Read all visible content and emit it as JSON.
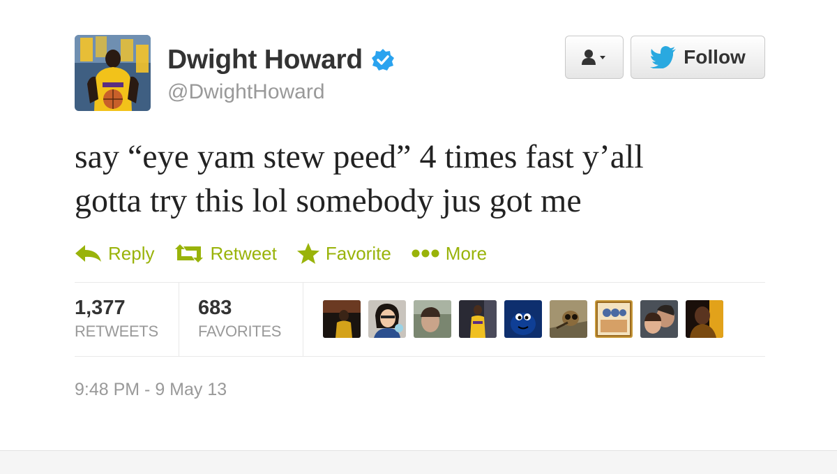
{
  "author": {
    "name": "Dwight Howard",
    "handle": "@DwightHoward",
    "verified": true,
    "avatar_icon": "player-photo-avatar"
  },
  "buttons": {
    "user_menu_icon": "user-dropdown-icon",
    "follow_label": "Follow"
  },
  "tweet": {
    "line1": "say “eye yam stew peed” 4 times fast y’all",
    "line2": "gotta try this lol somebody jus got me"
  },
  "actions": [
    {
      "label": "Reply",
      "icon": "reply-icon"
    },
    {
      "label": "Retweet",
      "icon": "retweet-icon"
    },
    {
      "label": "Favorite",
      "icon": "star-icon"
    },
    {
      "label": "More",
      "icon": "more-dots-icon"
    }
  ],
  "stats": {
    "retweets_count": "1,377",
    "retweets_label": "RETWEETS",
    "favorites_count": "683",
    "favorites_label": "FAVORITES"
  },
  "favorited_by_count": 9,
  "timestamp": "9:48 PM - 9 May 13",
  "colors": {
    "action_green": "#99b30a",
    "verified_blue": "#2aa3ef",
    "twitter_bird_blue": "#2aa9e0"
  }
}
